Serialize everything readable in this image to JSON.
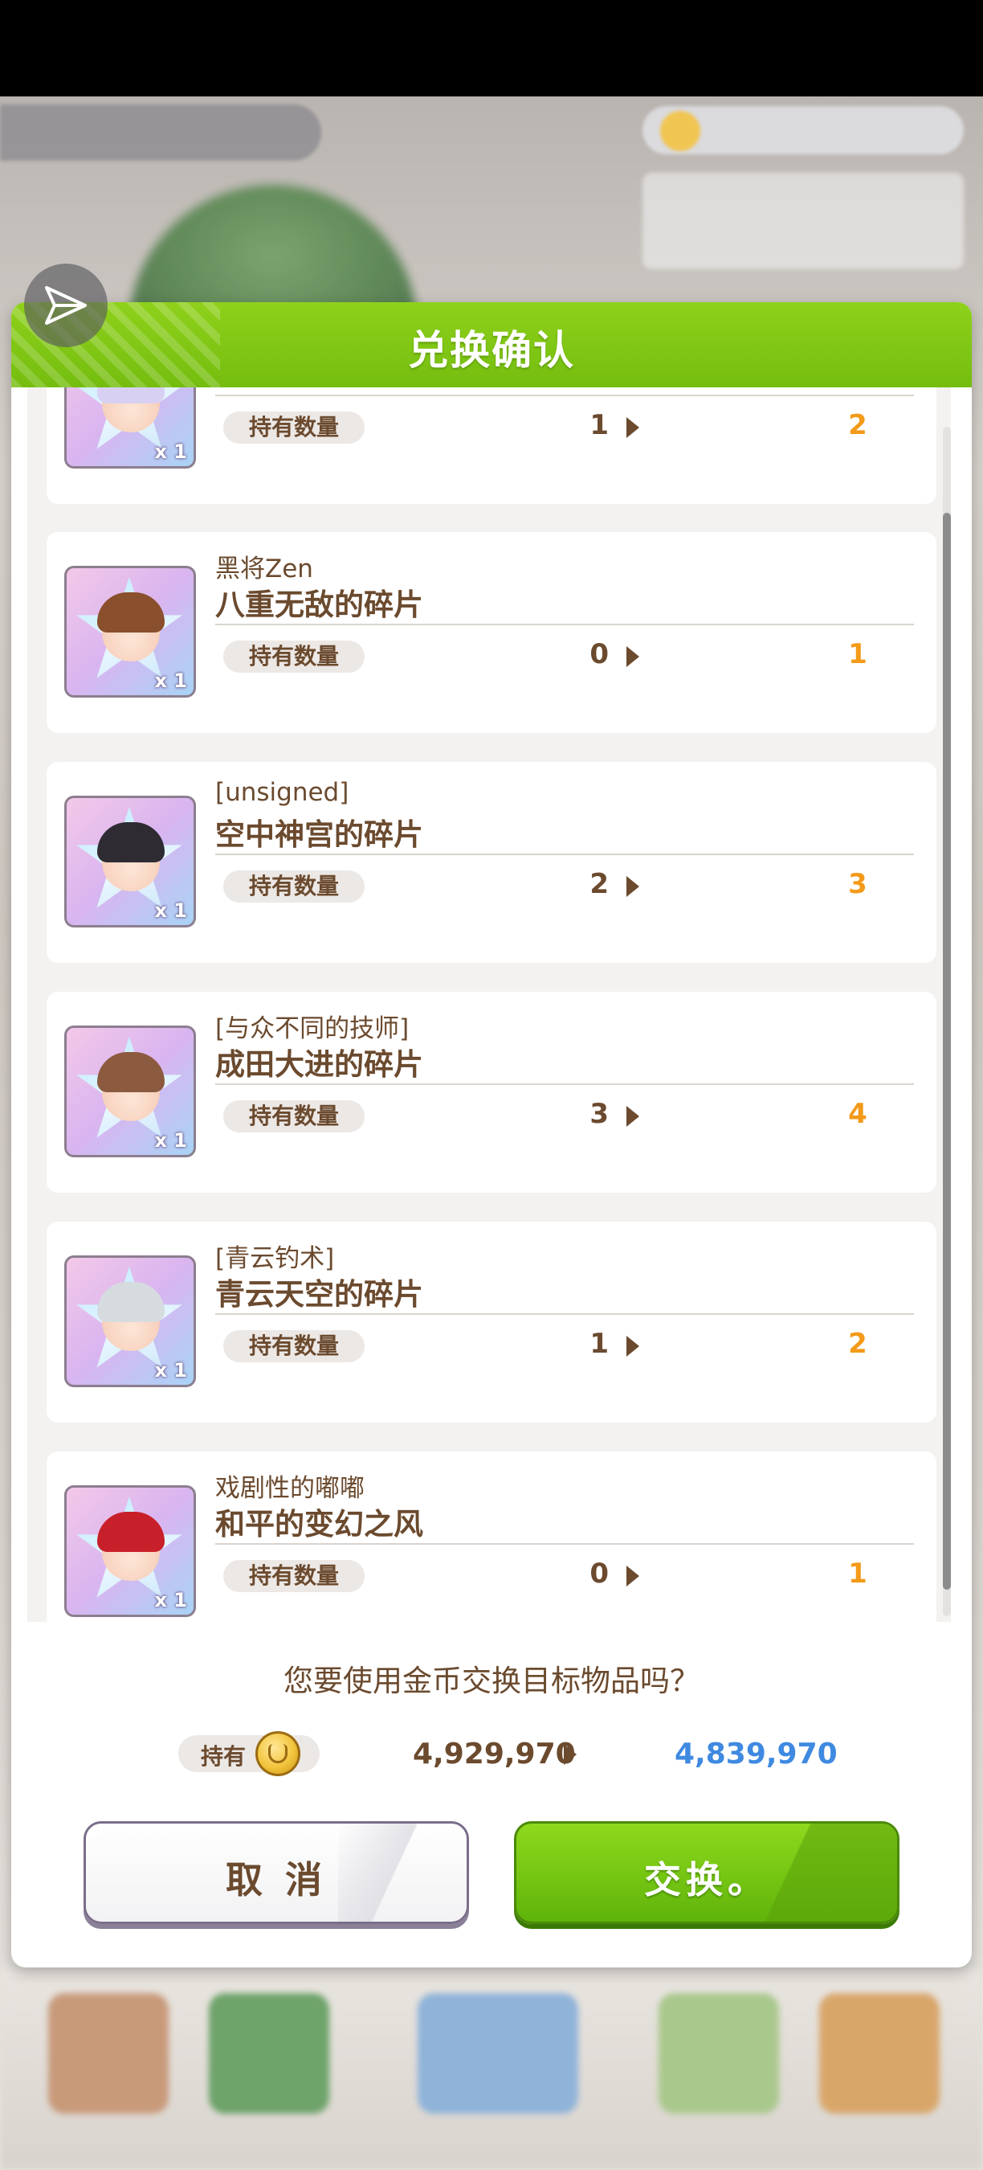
{
  "dialog": {
    "title": "兑换确认",
    "question": "您要使用金币交换目标物品吗？",
    "hold_label": "持有",
    "gold_current": "4,929,970",
    "gold_after": "4,839,970",
    "cancel_label": "取 消",
    "exchange_label": "交换。"
  },
  "items": [
    {
      "subtitle": "",
      "title": "",
      "qty_badge": "x 1",
      "hold_label": "持有数量",
      "from": "1",
      "to": "2",
      "hair": "#d8d0f2"
    },
    {
      "subtitle": "黑将Zen",
      "title": "八重无敌的碎片",
      "qty_badge": "x 1",
      "hold_label": "持有数量",
      "from": "0",
      "to": "1",
      "hair": "#8a4f2c"
    },
    {
      "subtitle": "[unsigned]",
      "title": "空中神宫的碎片",
      "qty_badge": "x 1",
      "hold_label": "持有数量",
      "from": "2",
      "to": "3",
      "hair": "#2e2b33"
    },
    {
      "subtitle": "[与众不同的技师]",
      "title": "成田大进的碎片",
      "qty_badge": "x 1",
      "hold_label": "持有数量",
      "from": "3",
      "to": "4",
      "hair": "#8c5a3e"
    },
    {
      "subtitle": "[青云钓术]",
      "title": "青云天空的碎片",
      "qty_badge": "x 1",
      "hold_label": "持有数量",
      "from": "1",
      "to": "2",
      "hair": "#d6dbe0"
    },
    {
      "subtitle": "戏剧性的嘟嘟",
      "title": "和平的变幻之风",
      "qty_badge": "x 1",
      "hold_label": "持有数量",
      "from": "0",
      "to": "1",
      "hair": "#c8202a"
    }
  ],
  "colors": {
    "header_green": "#7ec414",
    "count_to_orange": "#f39a19",
    "gold_after_blue": "#3f8ae0",
    "text_brown": "#6b4a2e"
  }
}
